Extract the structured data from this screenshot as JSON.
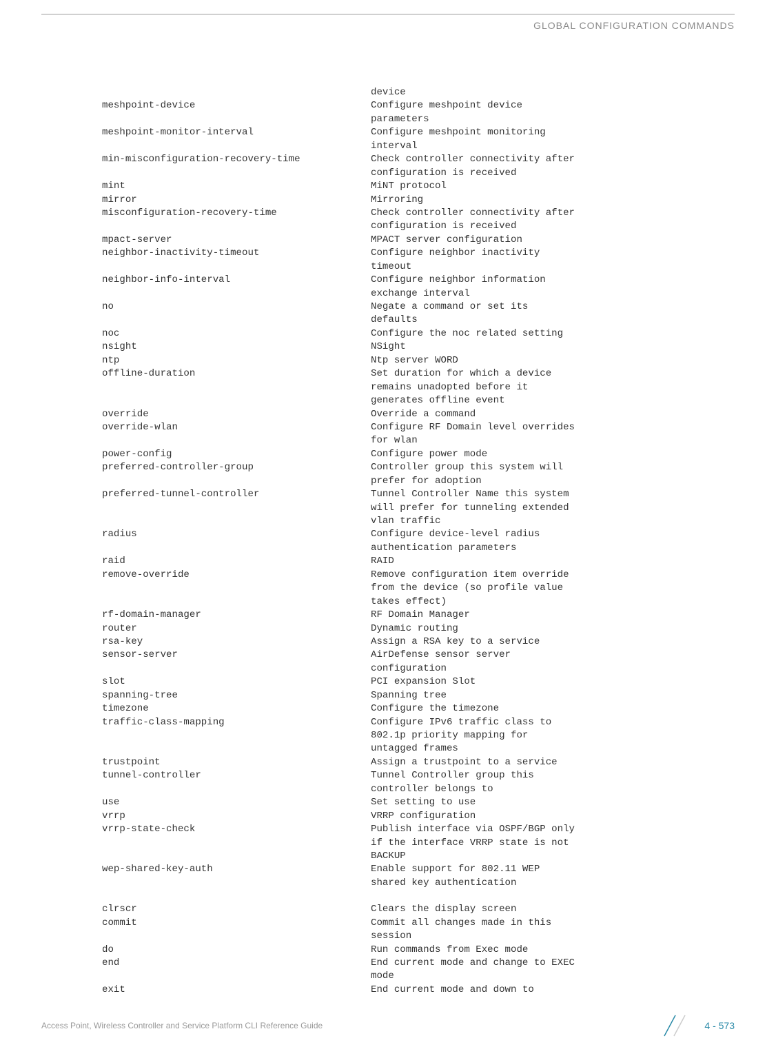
{
  "header": {
    "title": "GLOBAL CONFIGURATION COMMANDS"
  },
  "rows": [
    {
      "cmd": "",
      "desc": "device"
    },
    {
      "cmd": "meshpoint-device",
      "desc": "Configure meshpoint device"
    },
    {
      "cmd": "",
      "desc": "parameters"
    },
    {
      "cmd": "meshpoint-monitor-interval",
      "desc": "Configure meshpoint monitoring"
    },
    {
      "cmd": "",
      "desc": "interval"
    },
    {
      "cmd": "min-misconfiguration-recovery-time",
      "desc": "Check controller connectivity after"
    },
    {
      "cmd": "",
      "desc": "configuration is received"
    },
    {
      "cmd": "mint",
      "desc": "MiNT protocol"
    },
    {
      "cmd": "mirror",
      "desc": "Mirroring"
    },
    {
      "cmd": "misconfiguration-recovery-time",
      "desc": "Check controller connectivity after"
    },
    {
      "cmd": "",
      "desc": "configuration is received"
    },
    {
      "cmd": "mpact-server",
      "desc": "MPACT server configuration"
    },
    {
      "cmd": "neighbor-inactivity-timeout",
      "desc": "Configure neighbor inactivity"
    },
    {
      "cmd": "",
      "desc": "timeout"
    },
    {
      "cmd": "neighbor-info-interval",
      "desc": "Configure neighbor information"
    },
    {
      "cmd": "",
      "desc": "exchange interval"
    },
    {
      "cmd": "no",
      "desc": "Negate a command or set its"
    },
    {
      "cmd": "",
      "desc": "defaults"
    },
    {
      "cmd": "noc",
      "desc": "Configure the noc related setting"
    },
    {
      "cmd": "nsight",
      "desc": "NSight"
    },
    {
      "cmd": "ntp",
      "desc": "Ntp server WORD"
    },
    {
      "cmd": "offline-duration",
      "desc": "Set duration for which a device"
    },
    {
      "cmd": "",
      "desc": "remains unadopted before it"
    },
    {
      "cmd": "",
      "desc": "generates offline event"
    },
    {
      "cmd": "override",
      "desc": "Override a command"
    },
    {
      "cmd": "override-wlan",
      "desc": "Configure RF Domain level overrides"
    },
    {
      "cmd": "",
      "desc": "for wlan"
    },
    {
      "cmd": "power-config",
      "desc": "Configure power mode"
    },
    {
      "cmd": "preferred-controller-group",
      "desc": "Controller group this system will"
    },
    {
      "cmd": "",
      "desc": "prefer for adoption"
    },
    {
      "cmd": "preferred-tunnel-controller",
      "desc": "Tunnel Controller Name this system"
    },
    {
      "cmd": "",
      "desc": "will prefer for tunneling extended"
    },
    {
      "cmd": "",
      "desc": "vlan traffic"
    },
    {
      "cmd": "radius",
      "desc": "Configure device-level radius"
    },
    {
      "cmd": "",
      "desc": "authentication parameters"
    },
    {
      "cmd": "raid",
      "desc": "RAID"
    },
    {
      "cmd": "remove-override",
      "desc": "Remove configuration item override"
    },
    {
      "cmd": "",
      "desc": "from the device (so profile value"
    },
    {
      "cmd": "",
      "desc": "takes effect)"
    },
    {
      "cmd": "rf-domain-manager",
      "desc": "RF Domain Manager"
    },
    {
      "cmd": "router",
      "desc": "Dynamic routing"
    },
    {
      "cmd": "rsa-key",
      "desc": "Assign a RSA key to a service"
    },
    {
      "cmd": "sensor-server",
      "desc": "AirDefense sensor server"
    },
    {
      "cmd": "",
      "desc": "configuration"
    },
    {
      "cmd": "slot",
      "desc": "PCI expansion Slot"
    },
    {
      "cmd": "spanning-tree",
      "desc": "Spanning tree"
    },
    {
      "cmd": "timezone",
      "desc": "Configure the timezone"
    },
    {
      "cmd": "traffic-class-mapping",
      "desc": "Configure IPv6 traffic class to"
    },
    {
      "cmd": "",
      "desc": "802.1p priority mapping for"
    },
    {
      "cmd": "",
      "desc": "untagged frames"
    },
    {
      "cmd": "trustpoint",
      "desc": "Assign a trustpoint to a service"
    },
    {
      "cmd": "tunnel-controller",
      "desc": "Tunnel Controller group this"
    },
    {
      "cmd": "",
      "desc": "controller belongs to"
    },
    {
      "cmd": "use",
      "desc": "Set setting to use"
    },
    {
      "cmd": "vrrp",
      "desc": "VRRP configuration"
    },
    {
      "cmd": "vrrp-state-check",
      "desc": "Publish interface via OSPF/BGP only"
    },
    {
      "cmd": "",
      "desc": "if the interface VRRP state is not"
    },
    {
      "cmd": "",
      "desc": "BACKUP"
    },
    {
      "cmd": "wep-shared-key-auth",
      "desc": "Enable support for 802.11 WEP"
    },
    {
      "cmd": "",
      "desc": "shared key authentication"
    },
    {
      "cmd": "",
      "desc": "",
      "blank": true
    },
    {
      "cmd": "clrscr",
      "desc": "Clears the display screen"
    },
    {
      "cmd": "commit",
      "desc": "Commit all changes made in this"
    },
    {
      "cmd": "",
      "desc": "session"
    },
    {
      "cmd": "do",
      "desc": "Run commands from Exec mode"
    },
    {
      "cmd": "end",
      "desc": "End current mode and change to EXEC"
    },
    {
      "cmd": "",
      "desc": "mode"
    },
    {
      "cmd": "exit",
      "desc": "End current mode and down to"
    }
  ],
  "footer": {
    "left": "Access Point, Wireless Controller and Service Platform CLI Reference Guide",
    "page": "4 - 573"
  }
}
